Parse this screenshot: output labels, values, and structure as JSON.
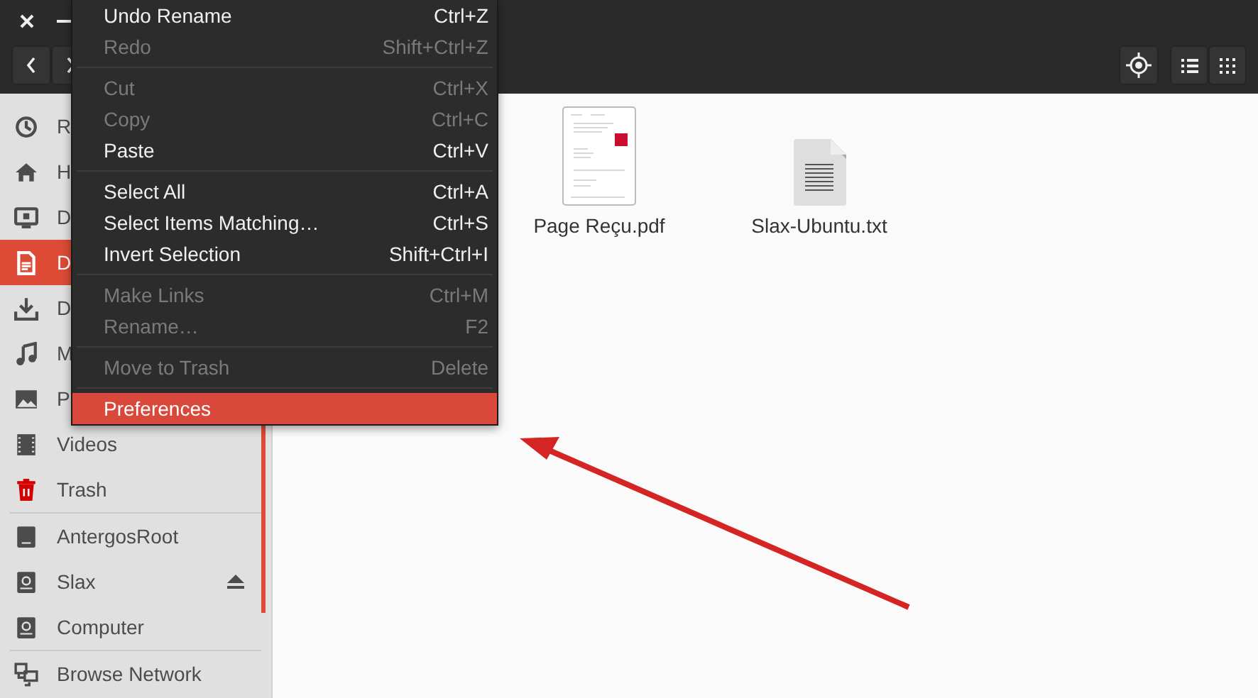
{
  "sidebar": {
    "sections": [
      [
        {
          "label": "R",
          "kind": "recent",
          "selected": false
        },
        {
          "label": "H",
          "kind": "home",
          "selected": false
        },
        {
          "label": "D",
          "kind": "desktop",
          "selected": false
        },
        {
          "label": "D",
          "kind": "documents",
          "selected": true
        },
        {
          "label": "D",
          "kind": "downloads",
          "selected": false
        },
        {
          "label": "M",
          "kind": "music",
          "selected": false
        },
        {
          "label": "P",
          "kind": "pictures",
          "selected": false
        },
        {
          "label": "Videos",
          "kind": "videos",
          "selected": false
        },
        {
          "label": "Trash",
          "kind": "trash",
          "selected": false
        }
      ],
      [
        {
          "label": "AntergosRoot",
          "kind": "drive",
          "selected": false
        },
        {
          "label": "Slax",
          "kind": "disk",
          "selected": false,
          "ejectable": true
        },
        {
          "label": "Computer",
          "kind": "disk",
          "selected": false
        }
      ],
      [
        {
          "label": "Browse Network",
          "kind": "network",
          "selected": false
        }
      ]
    ]
  },
  "files": [
    {
      "name": "Page Reçu.pdf",
      "kind": "pdf"
    },
    {
      "name": "Slax-Ubuntu.txt",
      "kind": "text"
    }
  ],
  "menu": {
    "sections": [
      [
        {
          "label": "Undo Rename",
          "shortcut": "Ctrl+Z",
          "disabled": false,
          "selected": false
        },
        {
          "label": "Redo",
          "shortcut": "Shift+Ctrl+Z",
          "disabled": true,
          "selected": false
        }
      ],
      [
        {
          "label": "Cut",
          "shortcut": "Ctrl+X",
          "disabled": true,
          "selected": false
        },
        {
          "label": "Copy",
          "shortcut": "Ctrl+C",
          "disabled": true,
          "selected": false
        },
        {
          "label": "Paste",
          "shortcut": "Ctrl+V",
          "disabled": false,
          "selected": false
        }
      ],
      [
        {
          "label": "Select All",
          "shortcut": "Ctrl+A",
          "disabled": false,
          "selected": false
        },
        {
          "label": "Select Items Matching…",
          "shortcut": "Ctrl+S",
          "disabled": false,
          "selected": false
        },
        {
          "label": "Invert Selection",
          "shortcut": "Shift+Ctrl+I",
          "disabled": false,
          "selected": false
        }
      ],
      [
        {
          "label": "Make Links",
          "shortcut": "Ctrl+M",
          "disabled": true,
          "selected": false
        },
        {
          "label": "Rename…",
          "shortcut": "F2",
          "disabled": true,
          "selected": false
        }
      ],
      [
        {
          "label": "Move to Trash",
          "shortcut": "Delete",
          "disabled": true,
          "selected": false
        }
      ],
      [
        {
          "label": "Preferences",
          "disabled": false,
          "selected": true
        }
      ]
    ]
  }
}
